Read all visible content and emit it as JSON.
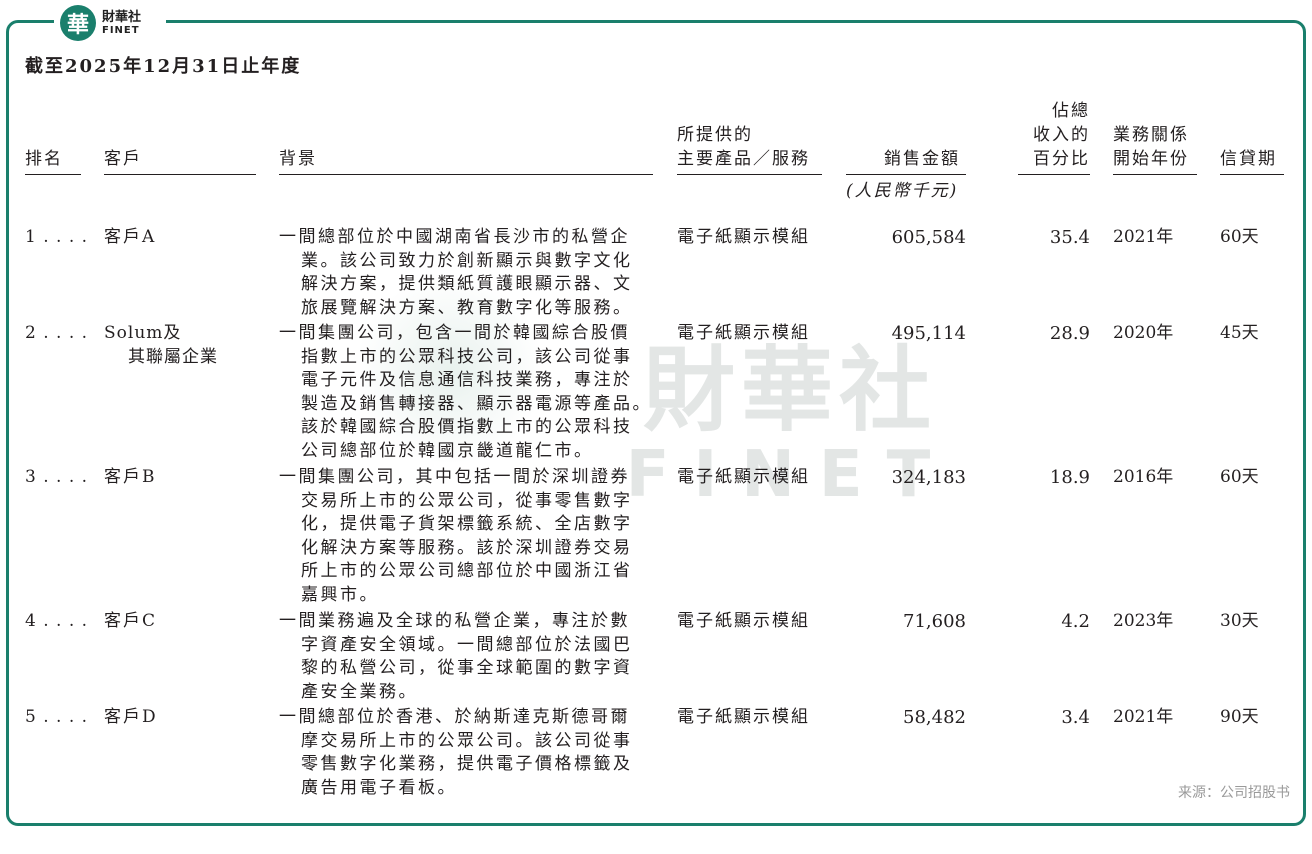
{
  "logo": {
    "mark": "華",
    "cn": "財華社",
    "en": "FINET"
  },
  "period": "截至2025年12月31日止年度",
  "watermark": {
    "cn": "財華社",
    "en": "FINET"
  },
  "headers": {
    "rank": "排名",
    "customer": "客戶",
    "background": "背景",
    "products": [
      "所提供的",
      "主要產品／服務"
    ],
    "sales": "銷售金額",
    "sales_unit": "(人民幣千元)",
    "pct": [
      "佔總",
      "收入的",
      "百分比"
    ],
    "since": [
      "業務關係",
      "開始年份"
    ],
    "credit": "信貸期"
  },
  "rows": [
    {
      "rank": "1 . . . .",
      "customer": [
        "客戶A"
      ],
      "background": [
        "一間總部位於中國湖南省長沙市的私營企",
        "業。該公司致力於創新顯示與數字文化",
        "解決方案，提供類紙質護眼顯示器、文",
        "旅展覽解決方案、教育數字化等服務。"
      ],
      "product": "電子紙顯示模組",
      "sales": "605,584",
      "pct": "35.4",
      "since": "2021年",
      "credit": "60天"
    },
    {
      "rank": "2 . . . .",
      "customer": [
        "Solum及",
        "其聯屬企業"
      ],
      "background": [
        "一間集團公司，包含一間於韓國綜合股價",
        "指數上市的公眾科技公司，該公司從事",
        "電子元件及信息通信科技業務，專注於",
        "製造及銷售轉接器、顯示器電源等產品。",
        "該於韓國綜合股價指數上市的公眾科技",
        "公司總部位於韓國京畿道龍仁市。"
      ],
      "product": "電子紙顯示模組",
      "sales": "495,114",
      "pct": "28.9",
      "since": "2020年",
      "credit": "45天"
    },
    {
      "rank": "3 . . . .",
      "customer": [
        "客戶B"
      ],
      "background": [
        "一間集團公司，其中包括一間於深圳證券",
        "交易所上市的公眾公司，從事零售數字",
        "化，提供電子貨架標籤系統、全店數字",
        "化解決方案等服務。該於深圳證券交易",
        "所上市的公眾公司總部位於中國浙江省",
        "嘉興市。"
      ],
      "product": "電子紙顯示模組",
      "sales": "324,183",
      "pct": "18.9",
      "since": "2016年",
      "credit": "60天"
    },
    {
      "rank": "4 . . . .",
      "customer": [
        "客戶C"
      ],
      "background": [
        "一間業務遍及全球的私營企業，專注於數",
        "字資產安全領域。一間總部位於法國巴",
        "黎的私營公司，從事全球範圍的數字資",
        "產安全業務。"
      ],
      "product": "電子紙顯示模組",
      "sales": "71,608",
      "pct": "4.2",
      "since": "2023年",
      "credit": "30天"
    },
    {
      "rank": "5 . . . .",
      "customer": [
        "客戶D"
      ],
      "background": [
        "一間總部位於香港、於納斯達克斯德哥爾",
        "摩交易所上市的公眾公司。該公司從事",
        "零售數字化業務，提供電子價格標籤及",
        "廣告用電子看板。"
      ],
      "product": "電子紙顯示模組",
      "sales": "58,482",
      "pct": "3.4",
      "since": "2021年",
      "credit": "90天"
    }
  ],
  "source": "来源：公司招股书"
}
